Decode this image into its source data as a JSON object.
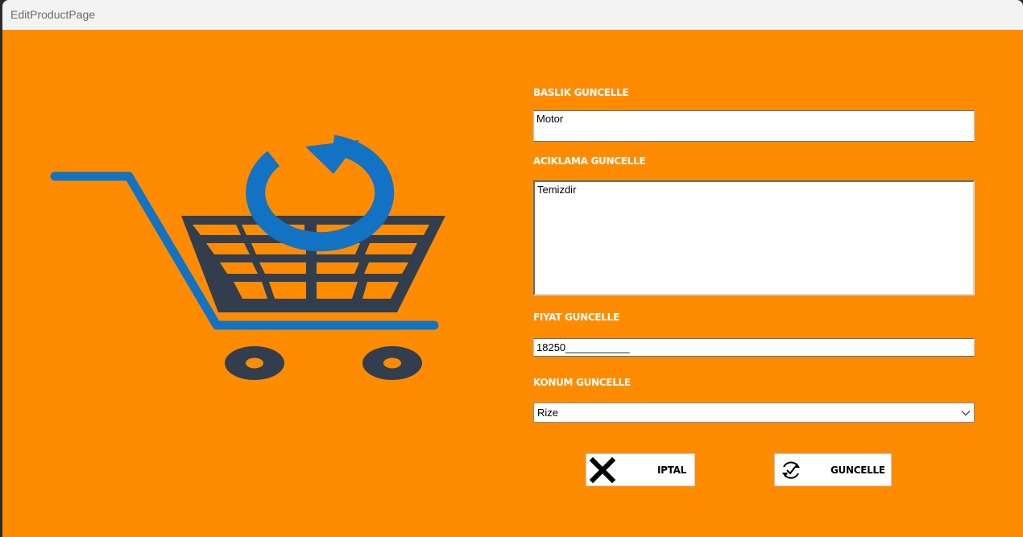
{
  "window": {
    "title": "EditProductPage"
  },
  "colors": {
    "background": "#ff8c00",
    "cart_dark": "#323e4e",
    "cart_blue": "#1273c4"
  },
  "form": {
    "title_label": "BASLIK GUNCELLE",
    "title_value": "Motor",
    "description_label": "ACIKLAMA GUNCELLE",
    "description_value": "Temizdir",
    "price_label": "FIYAT GUNCELLE",
    "price_value": "18250___________",
    "location_label": "KONUM GUNCELLE",
    "location_selected": "Rize"
  },
  "buttons": {
    "cancel_label": "IPTAL",
    "cancel_icon": "close-x-icon",
    "update_label": "GUNCELLE",
    "update_icon": "refresh-check-icon"
  },
  "illustration": {
    "icon": "shopping-cart-refresh-icon"
  }
}
